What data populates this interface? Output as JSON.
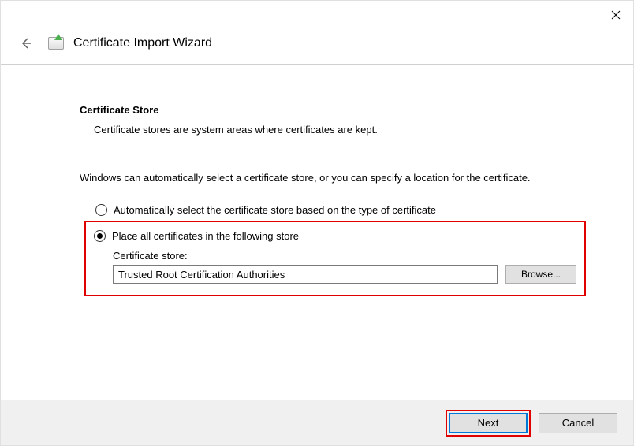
{
  "window": {
    "title": "Certificate Import Wizard"
  },
  "section": {
    "title": "Certificate Store",
    "description": "Certificate stores are system areas where certificates are kept."
  },
  "instruction": "Windows can automatically select a certificate store, or you can specify a location for the certificate.",
  "radio": {
    "auto_label": "Automatically select the certificate store based on the type of certificate",
    "manual_label": "Place all certificates in the following store",
    "selected": "manual"
  },
  "store": {
    "label": "Certificate store:",
    "value": "Trusted Root Certification Authorities",
    "browse_label": "Browse..."
  },
  "footer": {
    "next_label": "Next",
    "cancel_label": "Cancel"
  }
}
